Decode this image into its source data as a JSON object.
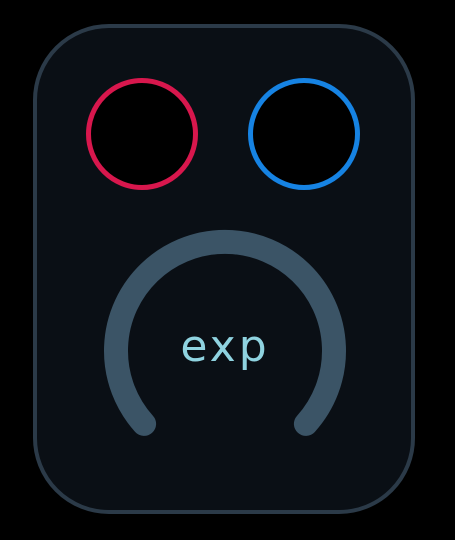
{
  "module": {
    "knob_label": "exp",
    "knob_value": 0
  },
  "colors": {
    "page_background": "#000000",
    "panel_background": "#0a0f15",
    "panel_border": "#2b3a48",
    "input_port_ring": "#d8174d",
    "output_port_ring": "#1683e3",
    "knob_track": "#3b5466",
    "label_text": "#8fd3e0"
  },
  "icons": {
    "input_port": "circle-outline-icon",
    "output_port": "circle-outline-icon"
  }
}
